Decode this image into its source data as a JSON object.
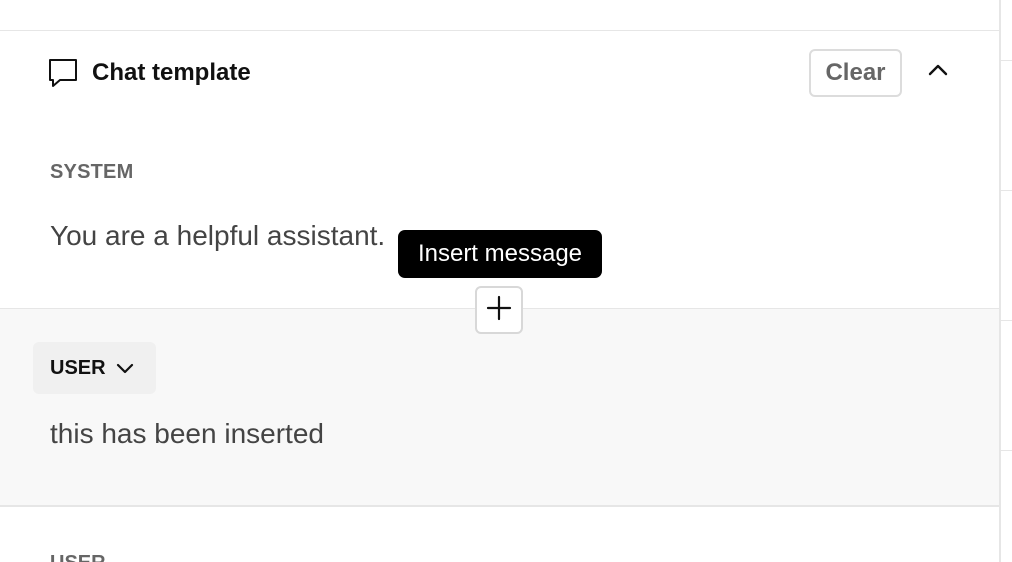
{
  "header": {
    "title": "Chat template",
    "icon": "chat-bubble-icon",
    "clear_label": "Clear",
    "collapse_icon": "chevron-up-icon"
  },
  "messages": [
    {
      "role": "SYSTEM",
      "content": "You are a helpful assistant."
    },
    {
      "role": "USER",
      "content": "this has been inserted"
    },
    {
      "role": "USER",
      "content": ""
    }
  ],
  "insert": {
    "tooltip": "Insert message",
    "icon": "plus-icon"
  },
  "colors": {
    "tooltip_bg": "#000000",
    "user_block_bg": "#f8f8f8",
    "border": "#e6e6e6"
  }
}
